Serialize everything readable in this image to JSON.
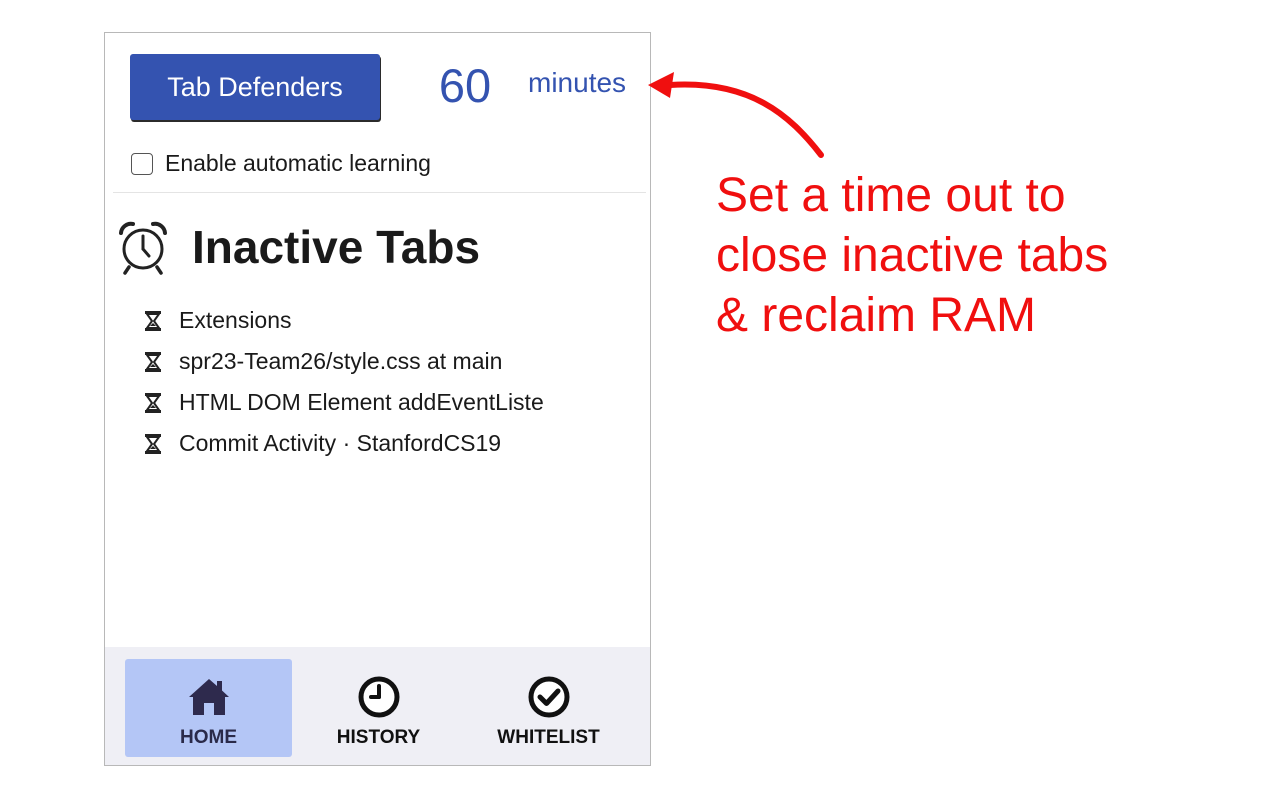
{
  "popup": {
    "brand_button_label": "Tab Defenders",
    "timeout_value": "60",
    "timeout_unit": "minutes",
    "auto_learning_label": "Enable automatic learning",
    "auto_learning_checked": false,
    "section_title": "Inactive Tabs",
    "section_icon": "alarm-clock-icon",
    "inactive_tabs": [
      {
        "icon": "hourglass-icon",
        "title": "Extensions"
      },
      {
        "icon": "hourglass-icon",
        "title": "spr23-Team26/style.css at main"
      },
      {
        "icon": "hourglass-icon",
        "title": "HTML DOM Element addEventListe"
      },
      {
        "icon": "hourglass-icon",
        "title": "Commit Activity · StanfordCS19"
      }
    ],
    "nav": [
      {
        "label": "HOME",
        "icon": "home-icon",
        "active": true
      },
      {
        "label": "HISTORY",
        "icon": "clock-icon",
        "active": false
      },
      {
        "label": "WHITELIST",
        "icon": "check-circle-icon",
        "active": false
      }
    ]
  },
  "annotation": {
    "lines": [
      "Set a time out to",
      "close inactive tabs",
      "& reclaim RAM"
    ],
    "color": "#f00f0f"
  },
  "colors": {
    "brand_blue": "#3453b0",
    "nav_background": "#efeff5",
    "nav_active": "#b4c6f6"
  }
}
